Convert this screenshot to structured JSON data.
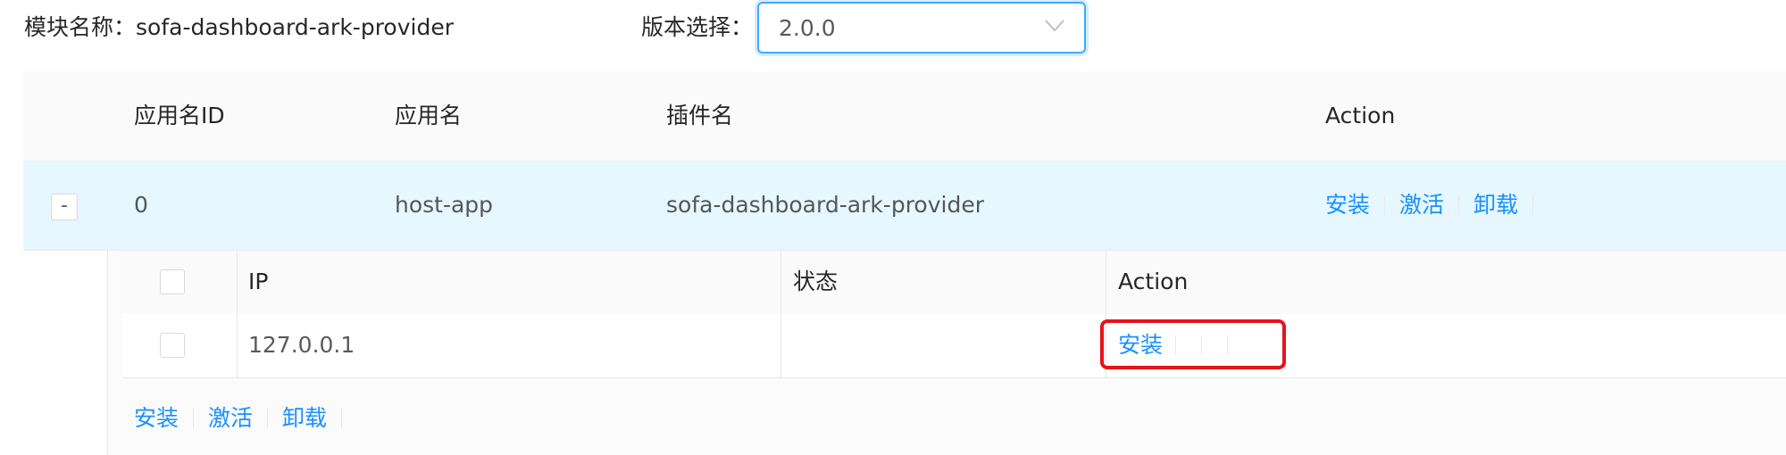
{
  "filter": {
    "module_label": "模块名称：sofa-dashboard-ark-provider",
    "version_label": "版本选择：",
    "version_value": "2.0.0",
    "version_icon": "chevron-down-icon"
  },
  "main_table": {
    "columns": [
      "应用名ID",
      "应用名",
      "插件名",
      "Action"
    ],
    "rows": [
      {
        "expand_symbol": "-",
        "id": "0",
        "app_name": "host-app",
        "plugin_name": "sofa-dashboard-ark-provider",
        "actions": [
          "安装",
          "激活",
          "卸载"
        ]
      }
    ]
  },
  "nested_table": {
    "columns": [
      "IP",
      "状态",
      "Action"
    ],
    "rows": [
      {
        "ip": "127.0.0.1",
        "status": "",
        "actions": [
          "安装"
        ]
      }
    ]
  },
  "bulk_actions": [
    "安装",
    "激活",
    "卸载"
  ],
  "colors": {
    "link": "#1890ff",
    "selected_row": "#e6f7ff",
    "highlight": "#e8121b",
    "focus_border": "#40a9ff"
  }
}
